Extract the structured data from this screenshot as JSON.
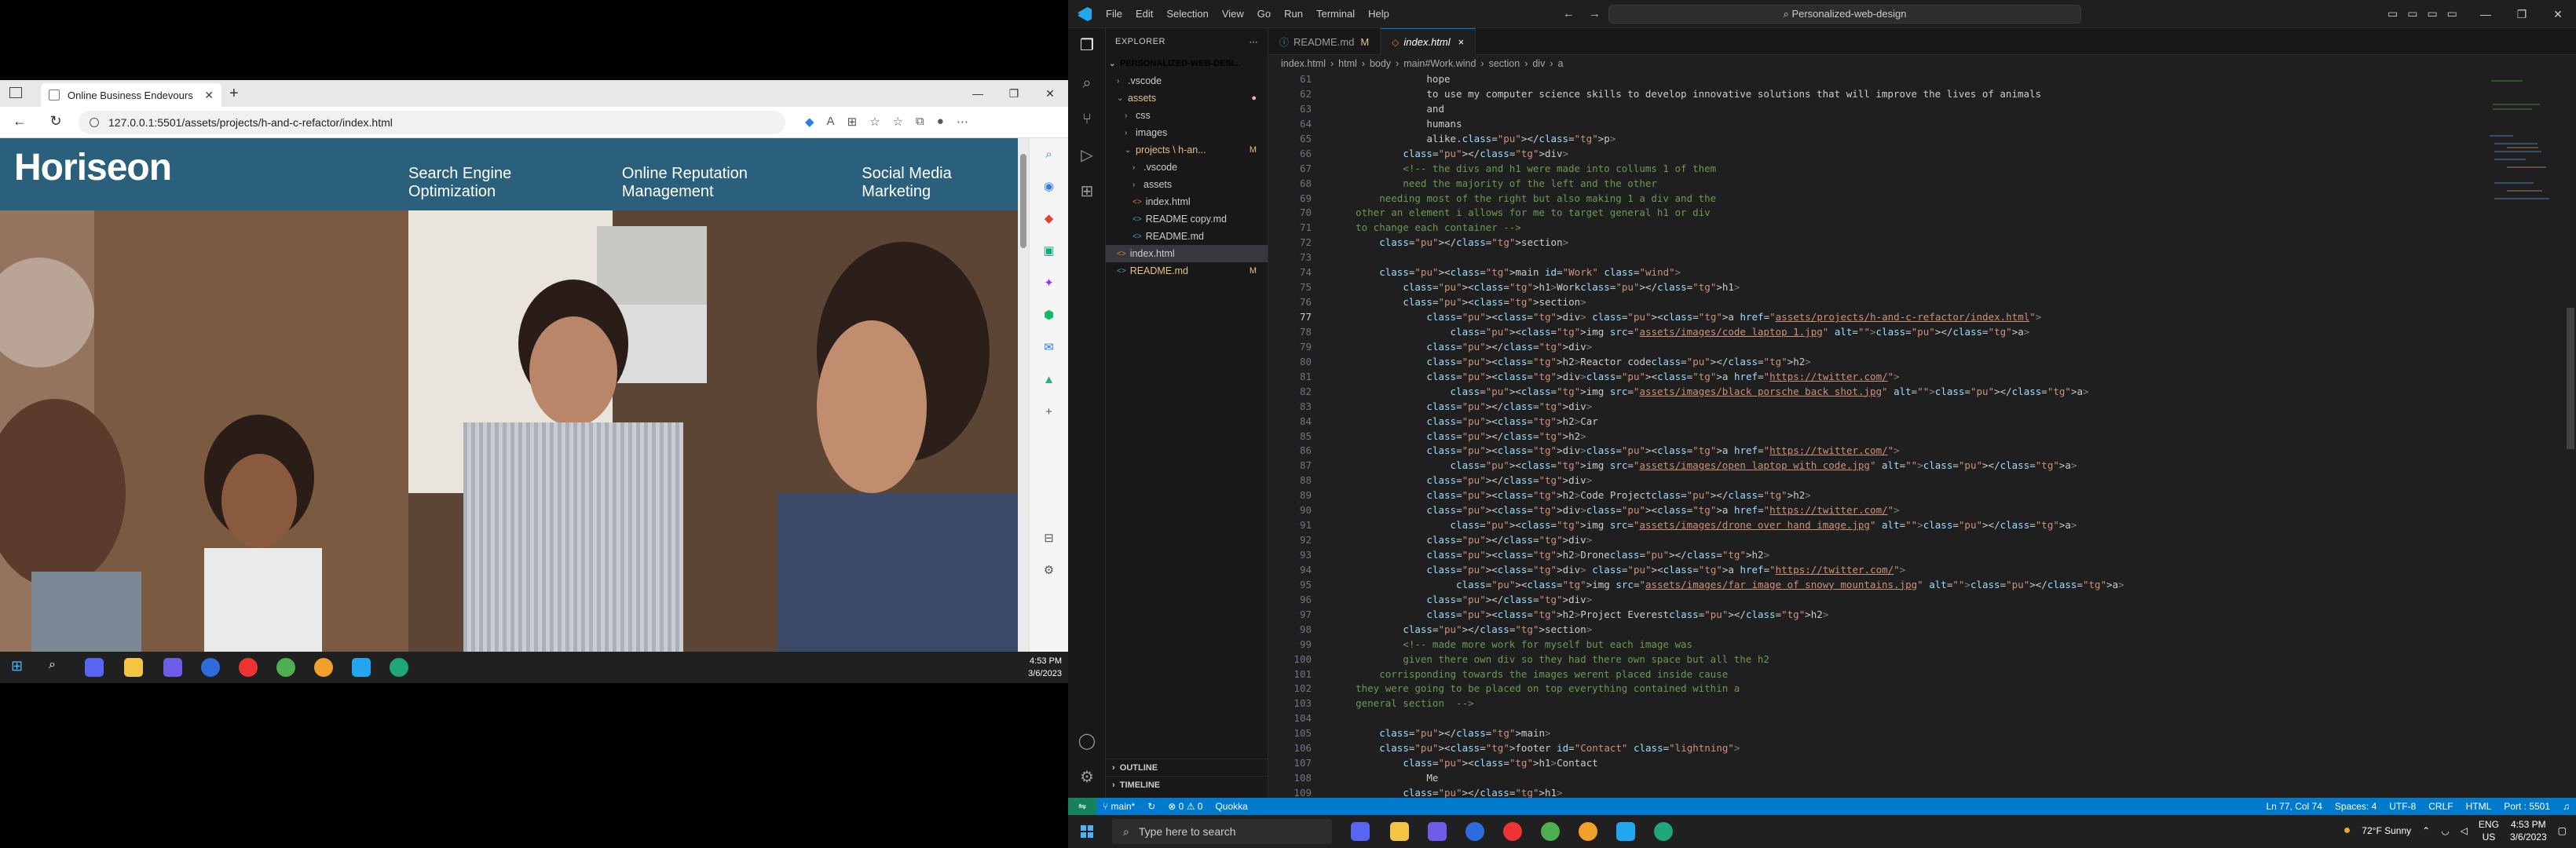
{
  "browser": {
    "tab_title": "Online Business Endevours",
    "url": "127.0.0.1:5501/assets/projects/h-and-c-refactor/index.html",
    "site": {
      "logo": "Horiseon",
      "nav": [
        "Search Engine Optimization",
        "Online Reputation Management",
        "Social Media Marketing"
      ]
    }
  },
  "left_taskbar": {
    "time": "4:53 PM",
    "date": "3/6/2023"
  },
  "vscode": {
    "menu": [
      "File",
      "Edit",
      "Selection",
      "View",
      "Go",
      "Run",
      "Terminal",
      "Help"
    ],
    "command_center": "Personalized-web-design",
    "explorer": {
      "title": "EXPLORER",
      "root": "PERSONALIZED-WEB-DESI...",
      "items": [
        {
          "label": ".vscode",
          "indent": 1,
          "folder": true,
          "open": false,
          "mod": false
        },
        {
          "label": "assets",
          "indent": 1,
          "folder": true,
          "open": true,
          "mod": true,
          "badge": "●"
        },
        {
          "label": "css",
          "indent": 2,
          "folder": true,
          "open": false,
          "mod": false
        },
        {
          "label": "images",
          "indent": 2,
          "folder": true,
          "open": false,
          "mod": false
        },
        {
          "label": "projects \\ h-an...",
          "indent": 2,
          "folder": true,
          "open": true,
          "mod": true,
          "badge": "M"
        },
        {
          "label": ".vscode",
          "indent": 3,
          "folder": true,
          "open": false,
          "mod": false
        },
        {
          "label": "assets",
          "indent": 3,
          "folder": true,
          "open": false,
          "mod": false
        },
        {
          "label": "index.html",
          "indent": 3,
          "folder": false,
          "mod": false
        },
        {
          "label": "README copy.md",
          "indent": 3,
          "folder": false,
          "mod": false
        },
        {
          "label": "README.md",
          "indent": 3,
          "folder": false,
          "mod": false
        },
        {
          "label": "index.html",
          "indent": 1,
          "folder": false,
          "mod": false,
          "sel": true
        },
        {
          "label": "README.md",
          "indent": 1,
          "folder": false,
          "mod": true,
          "badge": "M"
        }
      ],
      "outline": "OUTLINE",
      "timeline": "TIMELINE"
    },
    "tabs": [
      {
        "label": "README.md",
        "mark": "M",
        "active": false
      },
      {
        "label": "index.html",
        "mark": "×",
        "active": true
      }
    ],
    "breadcrumb": [
      "index.html",
      "html",
      "body",
      "main#Work.wind",
      "section",
      "div",
      "a"
    ],
    "code": [
      [
        61,
        "                hope"
      ],
      [
        62,
        "                to use my computer science skills to develop innovative solutions that will improve the lives of animals"
      ],
      [
        63,
        "                and"
      ],
      [
        64,
        "                humans"
      ],
      [
        65,
        "                alike.</p>"
      ],
      [
        66,
        "            </div>"
      ],
      [
        67,
        "            <!-- the divs and h1 were made into collums 1 of them"
      ],
      [
        68,
        "            need the majority of the left and the other"
      ],
      [
        69,
        "        needing most of the right but also making 1 a div and the"
      ],
      [
        70,
        "    other an element i allows for me to target general h1 or div"
      ],
      [
        71,
        "    to change each container -->"
      ],
      [
        72,
        "        </section>"
      ],
      [
        73,
        ""
      ],
      [
        74,
        "        <main id=\"Work\" class=\"wind\">"
      ],
      [
        75,
        "            <h1>Work</h1>"
      ],
      [
        76,
        "            <section>"
      ],
      [
        77,
        "                <div> <a href=\"assets/projects/h-and-c-refactor/index.html\">"
      ],
      [
        78,
        "                    <img src=\"assets/images/code laptop 1.jpg\" alt=\"\"></a>"
      ],
      [
        79,
        "                </div>"
      ],
      [
        80,
        "                <h2>Reactor code</h2>"
      ],
      [
        81,
        "                <div><a href=\"https://twitter.com/\">"
      ],
      [
        82,
        "                    <img src=\"assets/images/black porsche back shot.jpg\" alt=\"\"></a>"
      ],
      [
        83,
        "                </div>"
      ],
      [
        84,
        "                <h2>Car"
      ],
      [
        85,
        "                </h2>"
      ],
      [
        86,
        "                <div><a href=\"https://twitter.com/\">"
      ],
      [
        87,
        "                    <img src=\"assets/images/open laptop with code.jpg\" alt=\"\"></a>"
      ],
      [
        88,
        "                </div>"
      ],
      [
        89,
        "                <h2>Code Project</h2>"
      ],
      [
        90,
        "                <div><a href=\"https://twitter.com/\">"
      ],
      [
        91,
        "                    <img src=\"assets/images/drone over hand image.jpg\" alt=\"\"></a>"
      ],
      [
        92,
        "                </div>"
      ],
      [
        93,
        "                <h2>Drone</h2>"
      ],
      [
        94,
        "                <div> <a href=\"https://twitter.com/\">"
      ],
      [
        95,
        "                     <img src=\"assets/images/far image of snowy mountains.jpg\" alt=\"\"></a>"
      ],
      [
        96,
        "                </div>"
      ],
      [
        97,
        "                <h2>Project Everest</h2>"
      ],
      [
        98,
        "            </section>"
      ],
      [
        99,
        "            <!-- made more work for myself but each image was"
      ],
      [
        100,
        "            given there own div so they had there own space but all the h2"
      ],
      [
        101,
        "        corrisponding towards the images werent placed inside cause"
      ],
      [
        102,
        "    they were going to be placed on top everything contained within a"
      ],
      [
        103,
        "    general section  -->"
      ],
      [
        104,
        ""
      ],
      [
        105,
        "        </main>"
      ],
      [
        106,
        "        <footer id=\"Contact\" class=\"lightning\">"
      ],
      [
        107,
        "            <h1>Contact"
      ],
      [
        108,
        "                Me"
      ],
      [
        109,
        "            </h1>"
      ]
    ],
    "cursor_line": 77,
    "status": {
      "branch": "main*",
      "problems": "⊗ 0 ⚠ 0",
      "ext": "Quokka",
      "pos": "Ln 77, Col 74",
      "spaces": "Spaces: 4",
      "enc": "UTF-8",
      "eol": "CRLF",
      "lang": "HTML",
      "port": "Port : 5501"
    }
  },
  "taskbar": {
    "search_placeholder": "Type here to search",
    "weather": "72°F  Sunny",
    "lang": "ENG",
    "region": "US",
    "time": "4:53 PM",
    "date": "3/6/2023"
  }
}
